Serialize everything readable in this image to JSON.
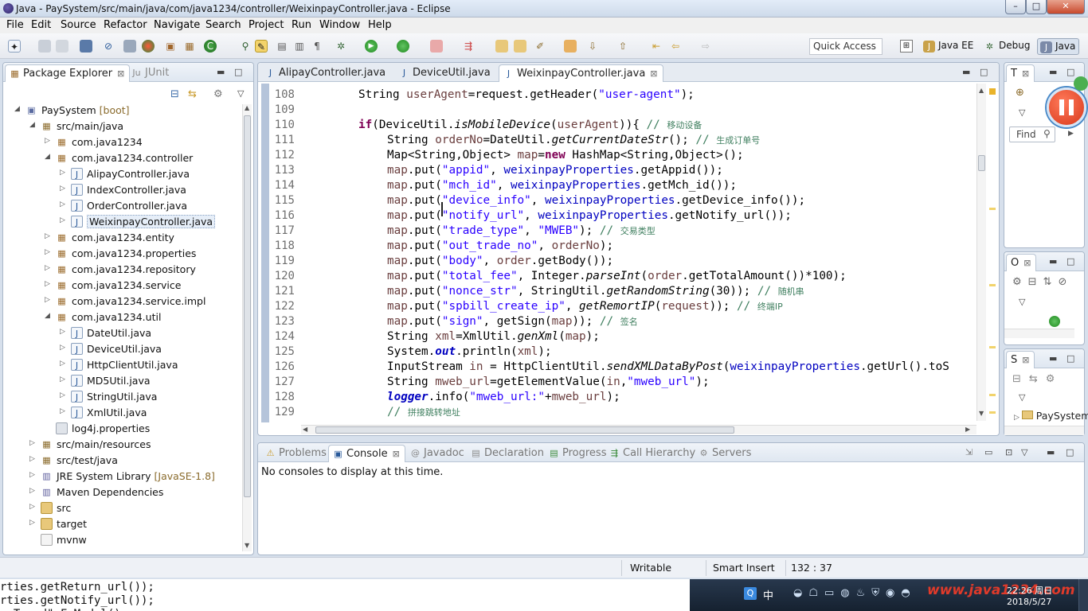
{
  "window": {
    "title": "Java - PaySystem/src/main/java/com/java1234/controller/WeixinpayController.java - Eclipse",
    "controls": [
      "–",
      "□",
      "✕"
    ]
  },
  "menu": [
    "File",
    "Edit",
    "Source",
    "Refactor",
    "Navigate",
    "Search",
    "Project",
    "Run",
    "Window",
    "Help"
  ],
  "toolbar": {
    "quick_access": "Quick Access",
    "perspectives": [
      {
        "label": "Java EE",
        "icon": "java-ee-icon"
      },
      {
        "label": "Debug",
        "icon": "bug-icon"
      },
      {
        "label": "Java",
        "icon": "java-icon"
      }
    ]
  },
  "explorer": {
    "tabs": [
      {
        "label": "Package Explorer",
        "icon": "package-explorer-icon"
      },
      {
        "label": "JUnit",
        "icon": "junit-icon"
      }
    ],
    "tree": [
      {
        "indent": 0,
        "arrow": "◢",
        "icon": "project-icon",
        "label": "PaySystem",
        "decor": " [boot]"
      },
      {
        "indent": 1,
        "arrow": "◢",
        "icon": "source-folder-icon",
        "label": "src/main/java"
      },
      {
        "indent": 2,
        "arrow": "▷",
        "icon": "package-icon",
        "label": "com.java1234"
      },
      {
        "indent": 2,
        "arrow": "◢",
        "icon": "package-icon",
        "label": "com.java1234.controller"
      },
      {
        "indent": 3,
        "arrow": "▷",
        "icon": "java-file-icon",
        "label": "AlipayController.java"
      },
      {
        "indent": 3,
        "arrow": "▷",
        "icon": "java-file-icon",
        "label": "IndexController.java"
      },
      {
        "indent": 3,
        "arrow": "▷",
        "icon": "java-file-icon",
        "label": "OrderController.java"
      },
      {
        "indent": 3,
        "arrow": "▷",
        "icon": "java-file-icon",
        "label": "WeixinpayController.java",
        "selected": true
      },
      {
        "indent": 2,
        "arrow": "▷",
        "icon": "package-icon",
        "label": "com.java1234.entity"
      },
      {
        "indent": 2,
        "arrow": "▷",
        "icon": "package-icon",
        "label": "com.java1234.properties"
      },
      {
        "indent": 2,
        "arrow": "▷",
        "icon": "package-icon",
        "label": "com.java1234.repository"
      },
      {
        "indent": 2,
        "arrow": "▷",
        "icon": "package-icon",
        "label": "com.java1234.service"
      },
      {
        "indent": 2,
        "arrow": "▷",
        "icon": "package-icon",
        "label": "com.java1234.service.impl"
      },
      {
        "indent": 2,
        "arrow": "◢",
        "icon": "package-icon",
        "label": "com.java1234.util"
      },
      {
        "indent": 3,
        "arrow": "▷",
        "icon": "java-file-icon",
        "label": "DateUtil.java"
      },
      {
        "indent": 3,
        "arrow": "▷",
        "icon": "java-file-icon",
        "label": "DeviceUtil.java"
      },
      {
        "indent": 3,
        "arrow": "▷",
        "icon": "java-file-icon",
        "label": "HttpClientUtil.java"
      },
      {
        "indent": 3,
        "arrow": "▷",
        "icon": "java-file-icon",
        "label": "MD5Util.java"
      },
      {
        "indent": 3,
        "arrow": "▷",
        "icon": "java-file-icon",
        "label": "StringUtil.java"
      },
      {
        "indent": 3,
        "arrow": "▷",
        "icon": "java-file-icon",
        "label": "XmlUtil.java"
      },
      {
        "indent": 2,
        "arrow": "",
        "icon": "properties-file-icon",
        "label": "log4j.properties"
      },
      {
        "indent": 1,
        "arrow": "▷",
        "icon": "source-folder-icon",
        "label": "src/main/resources"
      },
      {
        "indent": 1,
        "arrow": "▷",
        "icon": "source-folder-icon",
        "label": "src/test/java"
      },
      {
        "indent": 1,
        "arrow": "▷",
        "icon": "library-icon",
        "label": "JRE System Library",
        "decor": " [JavaSE-1.8]"
      },
      {
        "indent": 1,
        "arrow": "▷",
        "icon": "library-icon",
        "label": "Maven Dependencies"
      },
      {
        "indent": 1,
        "arrow": "▷",
        "icon": "folder-icon",
        "label": "src"
      },
      {
        "indent": 1,
        "arrow": "▷",
        "icon": "folder-icon",
        "label": "target"
      },
      {
        "indent": 1,
        "arrow": "",
        "icon": "file-icon",
        "label": "mvnw"
      }
    ]
  },
  "editor": {
    "tabs": [
      {
        "label": "AlipayController.java",
        "active": false
      },
      {
        "label": "DeviceUtil.java",
        "active": false
      },
      {
        "label": "WeixinpayController.java",
        "active": true
      }
    ],
    "lines": [
      {
        "n": "108",
        "ind": 2,
        "t": [
          [
            "String ",
            ""
          ],
          [
            "userAgent",
            "var"
          ],
          [
            "=request.getHeader(",
            ""
          ],
          [
            "\"user-agent\"",
            "st"
          ],
          [
            ");",
            ""
          ]
        ]
      },
      {
        "n": "109",
        "ind": 0,
        "t": []
      },
      {
        "n": "110",
        "ind": 2,
        "t": [
          [
            "if",
            "kw"
          ],
          [
            "(DeviceUtil.",
            ""
          ],
          [
            "isMobileDevice",
            "it"
          ],
          [
            "(",
            ""
          ],
          [
            "userAgent",
            "var"
          ],
          [
            ")){ ",
            ""
          ],
          [
            "// ",
            "cm"
          ],
          [
            "移动设备",
            "cmf"
          ]
        ]
      },
      {
        "n": "111",
        "ind": 3,
        "t": [
          [
            "String ",
            ""
          ],
          [
            "orderNo",
            "var"
          ],
          [
            "=DateUtil.",
            ""
          ],
          [
            "getCurrentDateStr",
            "it"
          ],
          [
            "(); ",
            ""
          ],
          [
            "// ",
            "cm"
          ],
          [
            "生成订单号",
            "cmf"
          ]
        ]
      },
      {
        "n": "112",
        "ind": 3,
        "t": [
          [
            "Map<String,Object> ",
            ""
          ],
          [
            "map",
            "var"
          ],
          [
            "=",
            ""
          ],
          [
            "new",
            "kw"
          ],
          [
            " HashMap<String,Object>();",
            ""
          ]
        ]
      },
      {
        "n": "113",
        "ind": 3,
        "t": [
          [
            "map",
            "var"
          ],
          [
            ".put(",
            ""
          ],
          [
            "\"appid\"",
            "st"
          ],
          [
            ", ",
            ""
          ],
          [
            "weixinpayProperties",
            "fd"
          ],
          [
            ".getAppid());",
            ""
          ]
        ]
      },
      {
        "n": "114",
        "ind": 3,
        "t": [
          [
            "map",
            "var"
          ],
          [
            ".put(",
            ""
          ],
          [
            "\"mch_id\"",
            "st"
          ],
          [
            ", ",
            ""
          ],
          [
            "weixinpayProperties",
            "fd"
          ],
          [
            ".getMch_id());",
            ""
          ]
        ]
      },
      {
        "n": "115",
        "ind": 3,
        "t": [
          [
            "map",
            "var"
          ],
          [
            ".put(",
            ""
          ],
          [
            "\"device_info\"",
            "st"
          ],
          [
            ", ",
            ""
          ],
          [
            "weixinpayProperties",
            "fd"
          ],
          [
            ".getDevice_info());",
            ""
          ]
        ]
      },
      {
        "n": "116",
        "ind": 3,
        "t": [
          [
            "map",
            "var"
          ],
          [
            ".put(",
            ""
          ],
          [
            "\"notify_url\"",
            "st"
          ],
          [
            ", ",
            ""
          ],
          [
            "weixinpayProperties",
            "fd"
          ],
          [
            ".getNotify_url());",
            ""
          ]
        ]
      },
      {
        "n": "117",
        "ind": 3,
        "t": [
          [
            "map",
            "var"
          ],
          [
            ".put(",
            ""
          ],
          [
            "\"trade_type\"",
            "st"
          ],
          [
            ", ",
            ""
          ],
          [
            "\"MWEB\"",
            "st"
          ],
          [
            "); ",
            ""
          ],
          [
            "// ",
            "cm"
          ],
          [
            "交易类型",
            "cmf"
          ]
        ]
      },
      {
        "n": "118",
        "ind": 3,
        "t": [
          [
            "map",
            "var"
          ],
          [
            ".put(",
            ""
          ],
          [
            "\"out_trade_no\"",
            "st"
          ],
          [
            ", ",
            ""
          ],
          [
            "orderNo",
            "var"
          ],
          [
            ");",
            ""
          ]
        ]
      },
      {
        "n": "119",
        "ind": 3,
        "t": [
          [
            "map",
            "var"
          ],
          [
            ".put(",
            ""
          ],
          [
            "\"body\"",
            "st"
          ],
          [
            ", ",
            ""
          ],
          [
            "order",
            "var"
          ],
          [
            ".getBody());",
            ""
          ]
        ]
      },
      {
        "n": "120",
        "ind": 3,
        "t": [
          [
            "map",
            "var"
          ],
          [
            ".put(",
            ""
          ],
          [
            "\"total_fee\"",
            "st"
          ],
          [
            ", Integer.",
            ""
          ],
          [
            "parseInt",
            "it"
          ],
          [
            "(",
            ""
          ],
          [
            "order",
            "var"
          ],
          [
            ".getTotalAmount())*100);",
            ""
          ]
        ]
      },
      {
        "n": "121",
        "ind": 3,
        "t": [
          [
            "map",
            "var"
          ],
          [
            ".put(",
            ""
          ],
          [
            "\"nonce_str\"",
            "st"
          ],
          [
            ", StringUtil.",
            ""
          ],
          [
            "getRandomString",
            "it"
          ],
          [
            "(30)); ",
            ""
          ],
          [
            "// ",
            "cm"
          ],
          [
            "随机串",
            "cmf"
          ]
        ]
      },
      {
        "n": "122",
        "ind": 3,
        "t": [
          [
            "map",
            "var"
          ],
          [
            ".put(",
            ""
          ],
          [
            "\"spbill_create_ip\"",
            "st"
          ],
          [
            ", ",
            ""
          ],
          [
            "getRemortIP",
            "it"
          ],
          [
            "(",
            ""
          ],
          [
            "request",
            "var"
          ],
          [
            ")); ",
            ""
          ],
          [
            "// ",
            "cm"
          ],
          [
            "终端IP",
            "cmf"
          ]
        ]
      },
      {
        "n": "123",
        "ind": 3,
        "t": [
          [
            "map",
            "var"
          ],
          [
            ".put(",
            ""
          ],
          [
            "\"sign\"",
            "st"
          ],
          [
            ", getSign(",
            ""
          ],
          [
            "map",
            "var"
          ],
          [
            ")); ",
            ""
          ],
          [
            "// ",
            "cm"
          ],
          [
            "签名",
            "cmf"
          ]
        ]
      },
      {
        "n": "124",
        "ind": 3,
        "t": [
          [
            "String ",
            ""
          ],
          [
            "xml",
            "var"
          ],
          [
            "=XmlUtil.",
            ""
          ],
          [
            "genXml",
            "it"
          ],
          [
            "(",
            ""
          ],
          [
            "map",
            "var"
          ],
          [
            ");",
            ""
          ]
        ]
      },
      {
        "n": "125",
        "ind": 3,
        "t": [
          [
            "System.",
            ""
          ],
          [
            "out",
            "fdi"
          ],
          [
            ".println(",
            ""
          ],
          [
            "xml",
            "var"
          ],
          [
            ");",
            ""
          ]
        ]
      },
      {
        "n": "126",
        "ind": 3,
        "t": [
          [
            "InputStream ",
            ""
          ],
          [
            "in",
            "var"
          ],
          [
            " = HttpClientUtil.",
            ""
          ],
          [
            "sendXMLDataByPost",
            "it"
          ],
          [
            "(",
            ""
          ],
          [
            "weixinpayProperties",
            "fd"
          ],
          [
            ".getUrl().toS",
            ""
          ]
        ]
      },
      {
        "n": "127",
        "ind": 3,
        "t": [
          [
            "String ",
            ""
          ],
          [
            "mweb_url",
            "var"
          ],
          [
            "=getElementValue(",
            ""
          ],
          [
            "in",
            "var"
          ],
          [
            ",",
            ""
          ],
          [
            "\"mweb_url\"",
            "st"
          ],
          [
            ");",
            ""
          ]
        ]
      },
      {
        "n": "128",
        "ind": 3,
        "t": [
          [
            "logger",
            "fdi"
          ],
          [
            ".info(",
            ""
          ],
          [
            "\"mweb_url:\"",
            "st"
          ],
          [
            "+",
            ""
          ],
          [
            "mweb_url",
            "var"
          ],
          [
            ");",
            ""
          ]
        ]
      },
      {
        "n": "129",
        "ind": 3,
        "t": [
          [
            "// ",
            "cm"
          ],
          [
            "拼接跳转地址",
            "cmf"
          ]
        ]
      }
    ]
  },
  "bottom": {
    "tabs": [
      {
        "label": "Problems",
        "icon": "problems-icon",
        "active": false
      },
      {
        "label": "Console",
        "icon": "console-icon",
        "active": true
      },
      {
        "label": "Javadoc",
        "icon": "javadoc-icon",
        "active": false
      },
      {
        "label": "Declaration",
        "icon": "declaration-icon",
        "active": false
      },
      {
        "label": "Progress",
        "icon": "progress-icon",
        "active": false
      },
      {
        "label": "Call Hierarchy",
        "icon": "call-hierarchy-icon",
        "active": false
      },
      {
        "label": "Servers",
        "icon": "servers-icon",
        "active": false
      }
    ],
    "message": "No consoles to display at this time."
  },
  "right": {
    "task_tab": "T",
    "find_placeholder": "Find",
    "outline_tab": "O",
    "servers_tab": "S",
    "servers_item": "PaySystem"
  },
  "status": {
    "writable": "Writable",
    "insert_mode": "Smart Insert",
    "position": "132 : 37"
  },
  "background_code": [
    "rties.getReturn_url());",
    "rties.getNotify_url());",
    "  T   d\" F M d l()"
  ],
  "taskbar": {
    "time": "22:26 周日",
    "date": "2018/5/27",
    "watermark": "www.java1234.com",
    "ime": "中"
  }
}
